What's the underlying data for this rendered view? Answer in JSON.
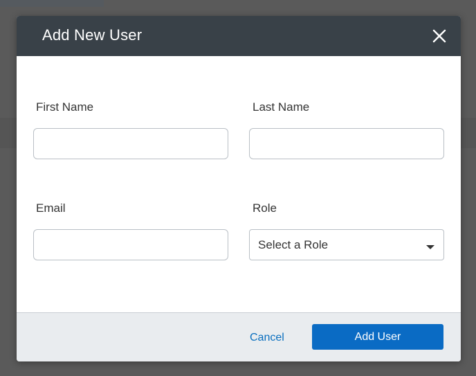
{
  "dialog": {
    "title": "Add New User"
  },
  "form": {
    "first_name": {
      "label": "First Name",
      "value": "",
      "placeholder": ""
    },
    "last_name": {
      "label": "Last Name",
      "value": "",
      "placeholder": ""
    },
    "email": {
      "label": "Email",
      "value": "",
      "placeholder": ""
    },
    "role": {
      "label": "Role",
      "selected": "Select a Role"
    }
  },
  "footer": {
    "cancel_label": "Cancel",
    "submit_label": "Add User"
  },
  "icons": {
    "close": "close-icon",
    "caret": "chevron-down-icon"
  },
  "colors": {
    "header_bg": "#394148",
    "primary": "#0a6bc4",
    "link": "#0a6fbf",
    "footer_bg": "#e9ecef"
  }
}
